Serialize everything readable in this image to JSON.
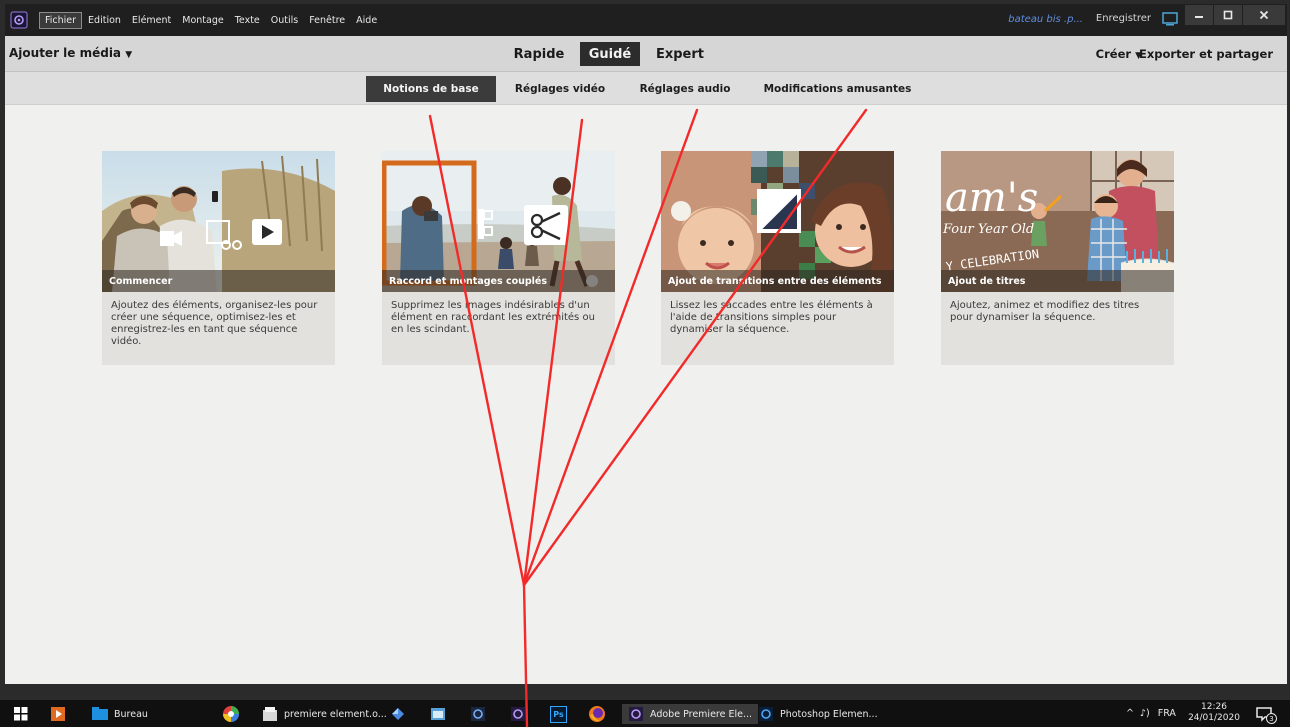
{
  "menubar": {
    "items": [
      "Fichier",
      "Edition",
      "Elément",
      "Montage",
      "Texte",
      "Outils",
      "Fenêtre",
      "Aide"
    ],
    "doc_name": "bateau bis .p...",
    "save_label": "Enregistrer"
  },
  "modebar": {
    "add_media": "Ajouter le média",
    "modes": [
      "Rapide",
      "Guidé",
      "Expert"
    ],
    "active_mode": "Guidé",
    "create": "Créer",
    "export": "Exporter et partager"
  },
  "subtabs": {
    "items": [
      "Notions de base",
      "Réglages vidéo",
      "Réglages audio",
      "Modifications amusantes"
    ],
    "active": "Notions de base"
  },
  "cards": [
    {
      "title": "Commencer",
      "description": "Ajoutez des éléments, organisez-les pour créer une séquence, optimisez-les et enregistrez-les en tant que séquence vidéo."
    },
    {
      "title": "Raccord et montages couplés",
      "description": "Supprimez les images indésirables d'un élément en raccordant les extrémités ou en les scindant."
    },
    {
      "title": "Ajout de transitions entre des éléments",
      "description": "Lissez les saccades entre les éléments à l'aide de transitions simples pour dynamiser la séquence."
    },
    {
      "title": "Ajout de titres",
      "description": "Ajoutez, animez et modifiez des titres pour dynamiser la séquence.",
      "image_text": {
        "big": "am's",
        "sub": "Four Year Old",
        "banner": "Y CELEBRATION"
      }
    }
  ],
  "taskbar": {
    "desktop_label": "Bureau",
    "file_label": "premiere element.o...",
    "premiere_label": "Adobe Premiere Ele...",
    "photoshop_label": "Photoshop Elemen...",
    "ps_icon_text": "Ps",
    "language": "FRA",
    "time": "12:26",
    "date": "24/01/2020",
    "notifications": "3"
  },
  "colors": {
    "annotation": "#f22a2a",
    "menubar": "#1f1f1f",
    "doc_name": "#5e8ee0",
    "active_tab": "#2c2c2c"
  }
}
